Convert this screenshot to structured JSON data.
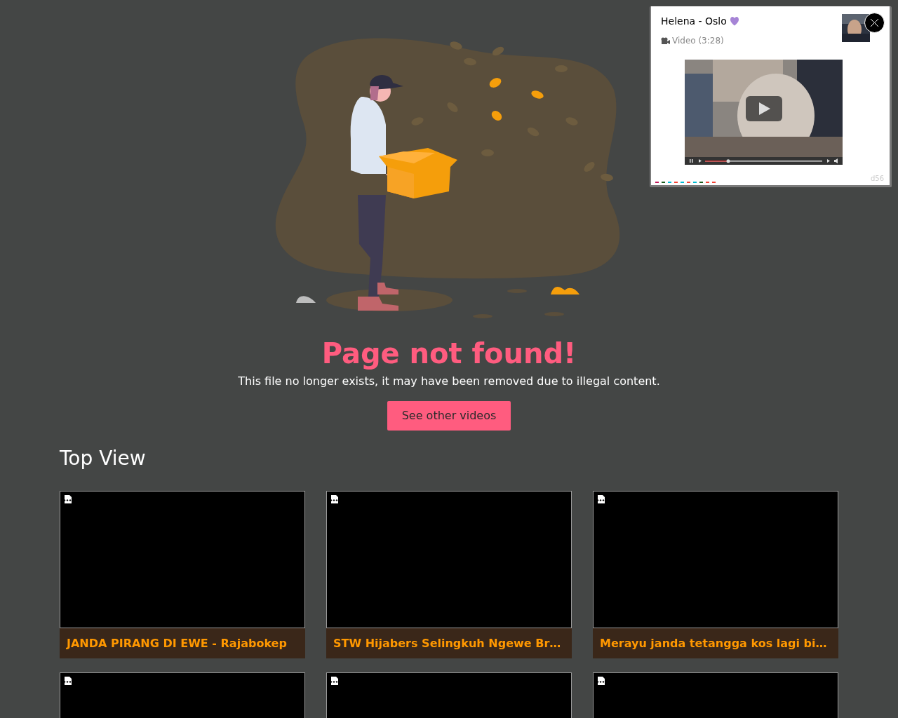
{
  "popup": {
    "title": "Helena - Oslo",
    "subtitle": "Video (3:28)",
    "badge": "d56"
  },
  "error": {
    "title": "Page not found!",
    "message": "This file no longer exists, it may have been removed due to illegal content.",
    "button": "See other videos"
  },
  "section": {
    "title": "Top View"
  },
  "cards": [
    {
      "kind": "full",
      "title": "JANDA PIRANG DI EWE - Rajabokep"
    },
    {
      "kind": "full",
      "title": "STW Hijabers Selingkuh Ngewe Br…"
    },
    {
      "kind": "full",
      "title": "Merayu janda tetangga kos lagi bi…"
    },
    {
      "kind": "cut_off"
    },
    {
      "kind": "cut_off"
    },
    {
      "kind": "cut_off"
    }
  ]
}
